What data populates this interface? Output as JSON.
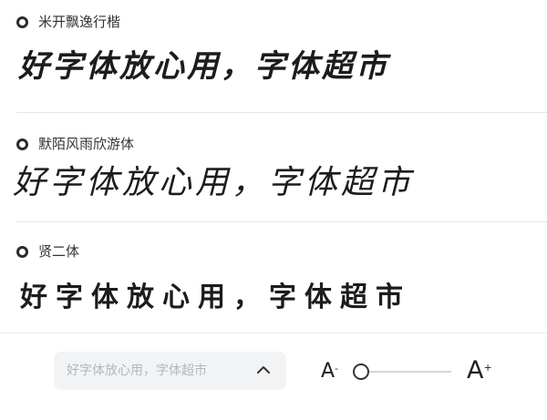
{
  "fonts": [
    {
      "name": "米开飘逸行楷",
      "preview": "好字体放心用，字体超市"
    },
    {
      "name": "默陌风雨欣游体",
      "preview": "好字体放心用，字体超市"
    },
    {
      "name": "贤二体",
      "preview": "好字体放心用，字体超市"
    }
  ],
  "toolbar": {
    "preview_text": "好字体放心用，字体超市",
    "chevron_icon": "chevron-up-icon",
    "size_decrease_label": "A",
    "size_decrease_mark": "-",
    "size_increase_label": "A",
    "size_increase_mark": "+",
    "font_size_level": 0.0
  }
}
